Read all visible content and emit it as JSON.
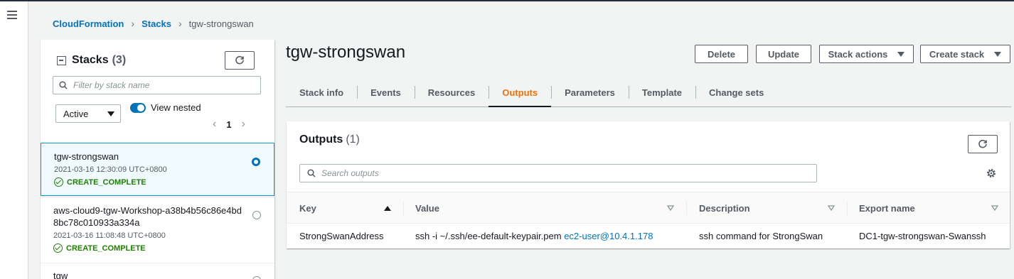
{
  "breadcrumb": {
    "root": "CloudFormation",
    "stacks": "Stacks",
    "current": "tgw-strongswan"
  },
  "sidebar": {
    "title": "Stacks",
    "count": "(3)",
    "filter_placeholder": "Filter by stack name",
    "status_filter": "Active",
    "view_nested_label": "View nested",
    "view_nested_on": true,
    "page": "1",
    "stacks": [
      {
        "name": "tgw-strongswan",
        "time": "2021-03-16 12:30:09 UTC+0800",
        "status": "CREATE_COMPLETE",
        "selected": true
      },
      {
        "name_line1": "aws-cloud9-tgw-Workshop-a38b4b56c86e4bd",
        "name_line2": "8bc78c010933a334a",
        "time": "2021-03-16 11:08:48 UTC+0800",
        "status": "CREATE_COMPLETE",
        "selected": false
      },
      {
        "name": "tgw",
        "selected": false
      }
    ]
  },
  "main": {
    "title": "tgw-strongswan",
    "buttons": {
      "delete": "Delete",
      "update": "Update",
      "stack_actions": "Stack actions",
      "create_stack": "Create stack"
    },
    "tabs": [
      "Stack info",
      "Events",
      "Resources",
      "Outputs",
      "Parameters",
      "Template",
      "Change sets"
    ],
    "active_tab": "Outputs"
  },
  "outputs": {
    "title": "Outputs",
    "count": "(1)",
    "search_placeholder": "Search outputs",
    "columns": [
      "Key",
      "Value",
      "Description",
      "Export name"
    ],
    "rows": [
      {
        "key": "StrongSwanAddress",
        "value_prefix": "ssh -i ~/.ssh/ee-default-keypair.pem",
        "value_link": "ec2-user@10.4.1.178",
        "description": "ssh command for StrongSwan",
        "export_name": "DC1-tgw-strongswan-Swanssh"
      }
    ]
  },
  "colors": {
    "accent": "#0073bb",
    "active_tab": "#ec7211",
    "success": "#1d8102"
  }
}
